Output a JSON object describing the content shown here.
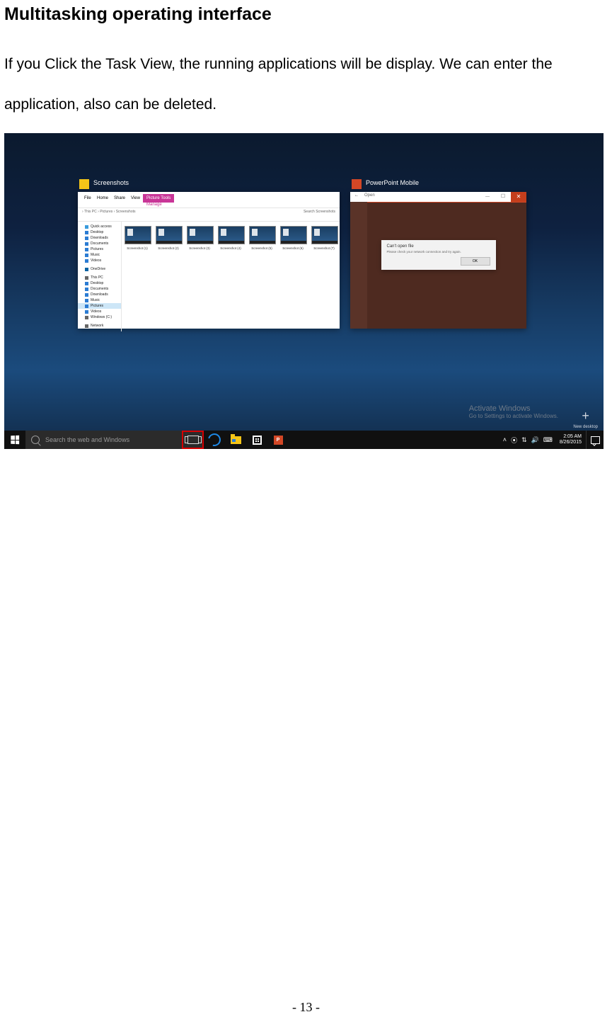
{
  "doc": {
    "heading": "Multitasking operating interface",
    "body": "If you Click the Task View, the running applications will be display. We can enter the application, also can be deleted.",
    "page_number": "- 13 -"
  },
  "screenshot": {
    "explorer": {
      "title": "Screenshots",
      "ribbon": {
        "tab_file": "File",
        "tab_home": "Home",
        "tab_share": "Share",
        "tab_view": "View",
        "tab_pic": "Picture Tools",
        "tab_manage": "Manage"
      },
      "breadcrumb": "› This PC › Pictures › Screenshots",
      "search_placeholder": "Search Screenshots",
      "nav": {
        "quick": "Quick access",
        "desktop": "Desktop",
        "downloads": "Downloads",
        "documents": "Documents",
        "pictures": "Pictures",
        "music": "Music",
        "videos": "Videos",
        "onedrive": "OneDrive",
        "thispc": "This PC",
        "pc_desktop": "Desktop",
        "pc_documents": "Documents",
        "pc_downloads": "Downloads",
        "pc_music": "Music",
        "pc_pictures": "Pictures",
        "pc_videos": "Videos",
        "pc_windows": "Windows (C:)",
        "network": "Network"
      },
      "thumbs": [
        "Screenshot (1)",
        "Screenshot (2)",
        "Screenshot (3)",
        "Screenshot (4)",
        "Screenshot (5)",
        "Screenshot (6)",
        "Screenshot (7)"
      ]
    },
    "ppt": {
      "title": "PowerPoint Mobile",
      "open": "Open",
      "dialog_title": "Can't open file",
      "dialog_msg": "Please check your network connection and try again.",
      "dialog_ok": "OK"
    },
    "activate": {
      "title": "Activate Windows",
      "sub": "Go to Settings to activate Windows."
    },
    "new_desktop": "New desktop",
    "taskbar": {
      "search_placeholder": "Search the web and Windows",
      "ppt_label": "P",
      "clock_time": "2:05 AM",
      "clock_date": "8/26/2015",
      "tray_chevron": "˄"
    }
  }
}
